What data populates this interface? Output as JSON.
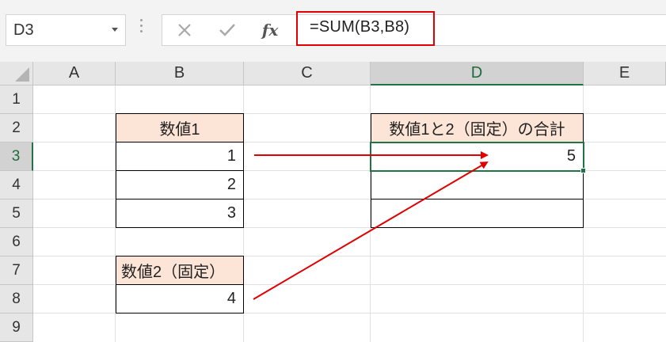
{
  "name_box": {
    "value": "D3"
  },
  "formula_bar": {
    "cancel_icon": "close-icon",
    "enter_icon": "check-icon",
    "function_label": "fx",
    "formula": "=SUM(B3,B8)",
    "highlight_color": "#e00000"
  },
  "columns": [
    "A",
    "B",
    "C",
    "D",
    "E"
  ],
  "rows": [
    "1",
    "2",
    "3",
    "4",
    "5",
    "6",
    "7",
    "8",
    "9"
  ],
  "selected": {
    "column": "D",
    "row": "3"
  },
  "cells": {
    "B2": "数値1",
    "B3": "1",
    "B4": "2",
    "B5": "3",
    "B7": "数値2（固定）",
    "B8": "4",
    "D2": "数値1と2（固定）の合計",
    "D3": "5",
    "D4": "",
    "D5": ""
  },
  "colors": {
    "header_fill": "#fce4d6",
    "selection_green": "#217346",
    "arrow_red": "#e00000"
  }
}
